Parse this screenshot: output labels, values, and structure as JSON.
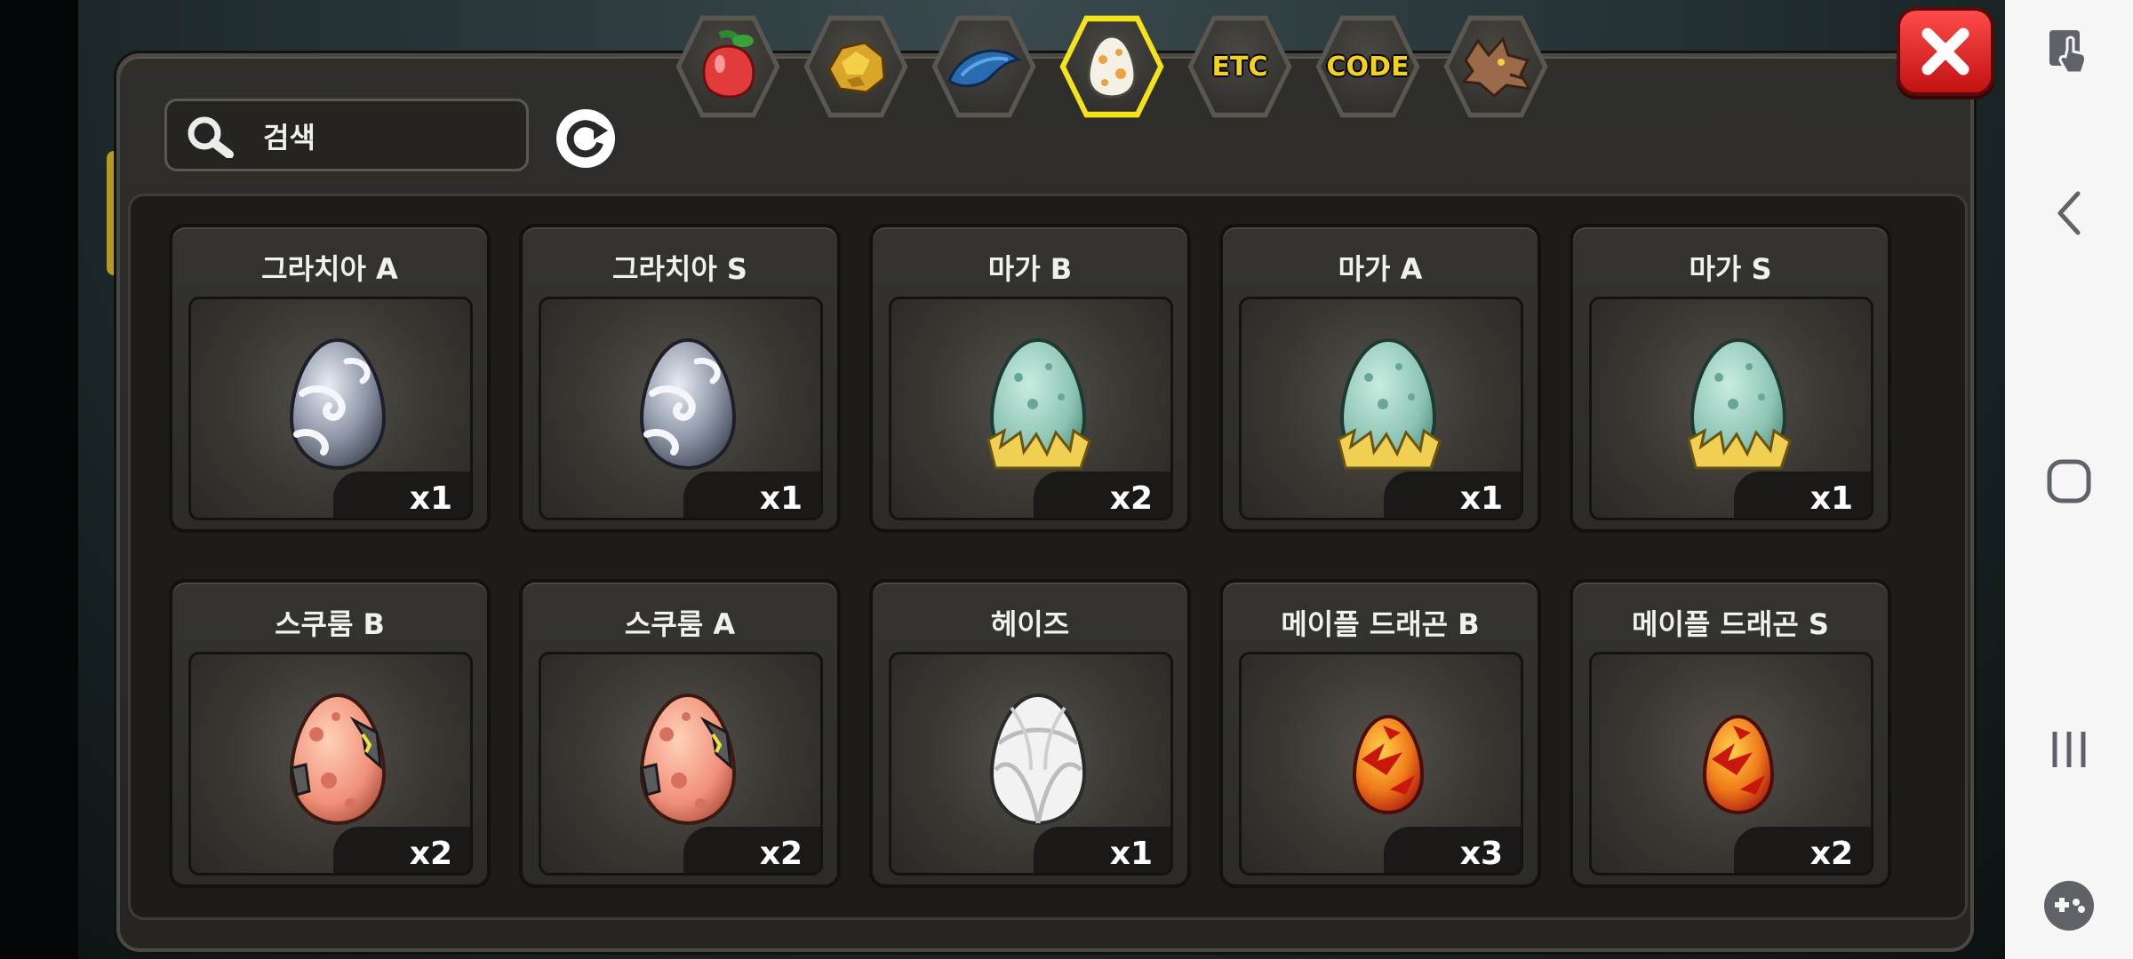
{
  "search": {
    "placeholder": "검색"
  },
  "tabs": [
    {
      "name": "fruit",
      "text": ""
    },
    {
      "name": "gold-ore",
      "text": ""
    },
    {
      "name": "fish",
      "text": ""
    },
    {
      "name": "egg",
      "text": "",
      "active": true
    },
    {
      "name": "etc",
      "text": "ETC"
    },
    {
      "name": "code",
      "text": "CODE"
    },
    {
      "name": "dragon",
      "text": ""
    }
  ],
  "items": [
    {
      "name": "그라치아 A",
      "qty": "x1",
      "egg": "silver"
    },
    {
      "name": "그라치아 S",
      "qty": "x1",
      "egg": "silver"
    },
    {
      "name": "마가 B",
      "qty": "x2",
      "egg": "mint"
    },
    {
      "name": "마가 A",
      "qty": "x1",
      "egg": "mint"
    },
    {
      "name": "마가 S",
      "qty": "x1",
      "egg": "mint"
    },
    {
      "name": "스쿠룸 B",
      "qty": "x2",
      "egg": "salmon"
    },
    {
      "name": "스쿠룸 A",
      "qty": "x2",
      "egg": "salmon"
    },
    {
      "name": "헤이즈",
      "qty": "x1",
      "egg": "white"
    },
    {
      "name": "메이플 드래곤 B",
      "qty": "x3",
      "egg": "fire"
    },
    {
      "name": "메이플 드래곤 S",
      "qty": "x2",
      "egg": "fire"
    }
  ],
  "colors": {
    "active_tab": "#f5e21b",
    "close": "#e02020",
    "tab_text": "#f4d21c"
  },
  "icons": {
    "search": "search-icon",
    "refresh": "refresh-icon",
    "close": "close-icon",
    "nav": [
      "screen-touch-icon",
      "back-icon",
      "home-icon",
      "recents-icon",
      "game-controller-icon"
    ]
  }
}
